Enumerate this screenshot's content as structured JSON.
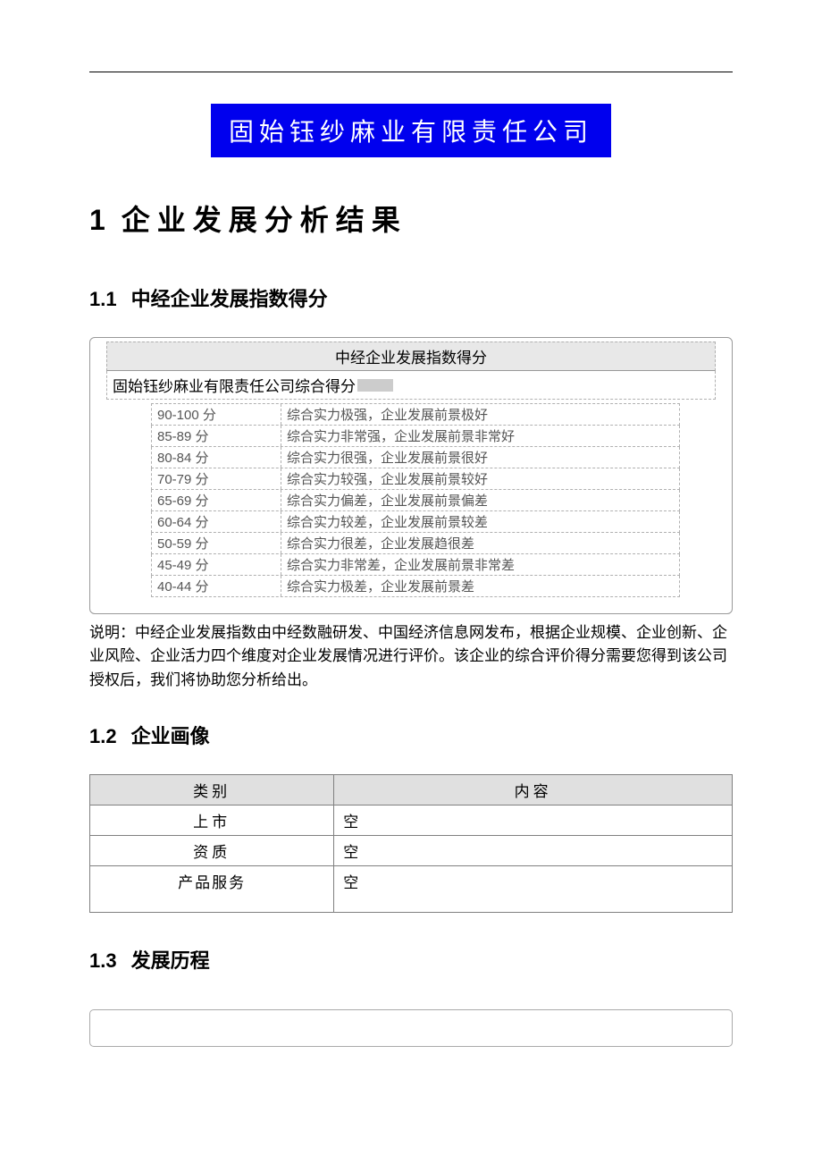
{
  "company_name": "固始钰纱麻业有限责任公司",
  "section1": {
    "number": "1",
    "title": "企业发展分析结果"
  },
  "section1_1": {
    "number": "1.1",
    "title": "中经企业发展指数得分"
  },
  "score_box": {
    "header": "中经企业发展指数得分",
    "company_score_label": "固始钰纱麻业有限责任公司综合得分",
    "rows": [
      {
        "range": "90-100 分",
        "desc": "综合实力极强，企业发展前景极好"
      },
      {
        "range": "85-89 分",
        "desc": "综合实力非常强，企业发展前景非常好"
      },
      {
        "range": "80-84 分",
        "desc": "综合实力很强，企业发展前景很好"
      },
      {
        "range": "70-79 分",
        "desc": "综合实力较强，企业发展前景较好"
      },
      {
        "range": "65-69 分",
        "desc": "综合实力偏差，企业发展前景偏差"
      },
      {
        "range": "60-64 分",
        "desc": "综合实力较差，企业发展前景较差"
      },
      {
        "range": "50-59 分",
        "desc": "综合实力很差，企业发展趋很差"
      },
      {
        "range": "45-49 分",
        "desc": "综合实力非常差，企业发展前景非常差"
      },
      {
        "range": "40-44 分",
        "desc": "综合实力极差，企业发展前景差"
      }
    ]
  },
  "note": "说明：中经企业发展指数由中经数融研发、中国经济信息网发布，根据企业规模、企业创新、企业风险、企业活力四个维度对企业发展情况进行评价。该企业的综合评价得分需要您得到该公司授权后，我们将协助您分析给出。",
  "section1_2": {
    "number": "1.2",
    "title": "企业画像"
  },
  "profile_table": {
    "header_category": "类别",
    "header_content": "内容",
    "rows": [
      {
        "category": "上市",
        "content": "空"
      },
      {
        "category": "资质",
        "content": "空"
      },
      {
        "category": "产品服务",
        "content": "空"
      }
    ]
  },
  "section1_3": {
    "number": "1.3",
    "title": "发展历程"
  }
}
